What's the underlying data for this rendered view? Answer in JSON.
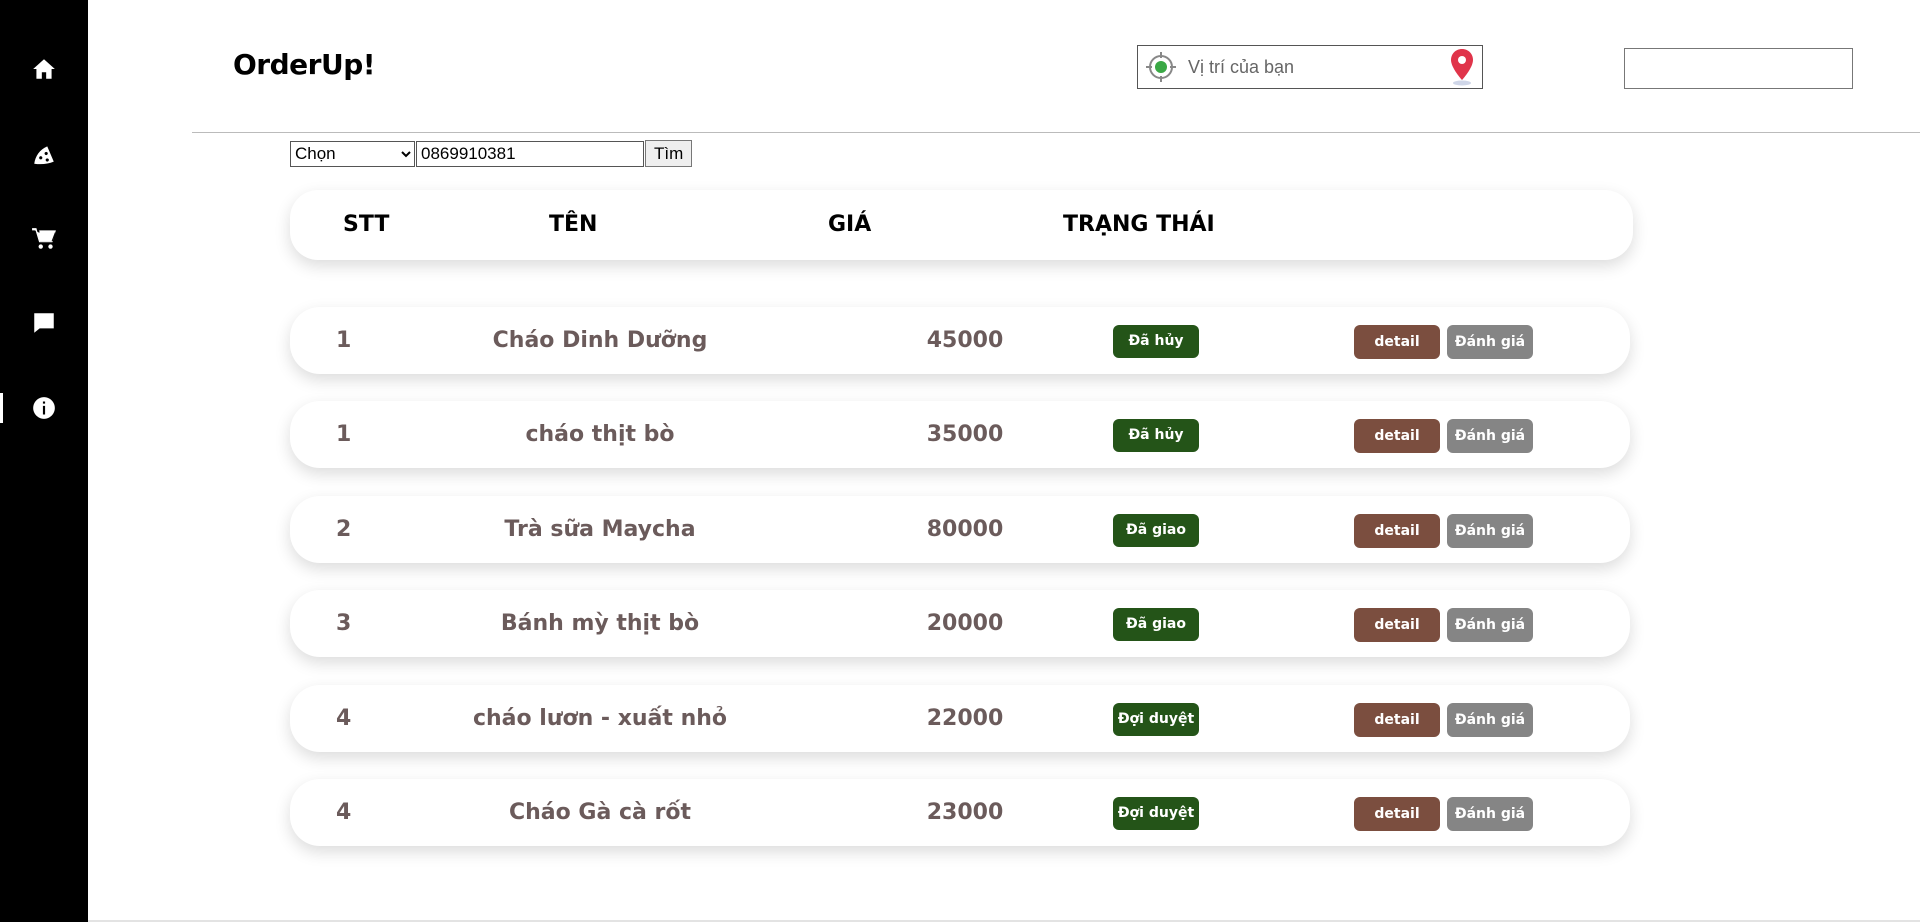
{
  "app": {
    "logo": "OrderUp!"
  },
  "sidebar": {
    "items": [
      {
        "icon": "home-icon",
        "active": false
      },
      {
        "icon": "pizza-icon",
        "active": false
      },
      {
        "icon": "cart-icon",
        "active": false
      },
      {
        "icon": "chat-icon",
        "active": false
      },
      {
        "icon": "info-icon",
        "active": true
      }
    ]
  },
  "header": {
    "location_placeholder": "Vị trí của bạn",
    "search_value": ""
  },
  "filter": {
    "select_value": "Chọn",
    "phone_value": "0869910381",
    "search_button": "Tìm"
  },
  "table": {
    "headers": {
      "stt": "STT",
      "name": "TÊN",
      "price": "GIÁ",
      "status": "TRẠNG THÁI"
    },
    "detail_label": "detail",
    "rate_label": "Đánh giá",
    "rows": [
      {
        "stt": "1",
        "name": "Cháo Dinh Dưỡng",
        "price": "45000",
        "status": "Đã hủy"
      },
      {
        "stt": "1",
        "name": "cháo thịt bò",
        "price": "35000",
        "status": "Đã hủy"
      },
      {
        "stt": "2",
        "name": "Trà sữa Maycha",
        "price": "80000",
        "status": "Đã giao"
      },
      {
        "stt": "3",
        "name": "Bánh mỳ thịt bò",
        "price": "20000",
        "status": "Đã giao"
      },
      {
        "stt": "4",
        "name": "cháo lươn - xuất nhỏ",
        "price": "22000",
        "status": "Đợi duyệt"
      },
      {
        "stt": "4",
        "name": "Cháo Gà cà rốt",
        "price": "23000",
        "status": "Đợi duyệt"
      }
    ]
  },
  "colors": {
    "sidebar": "#000000",
    "status_badge": "#245418",
    "detail_button": "#7b4e3f",
    "rate_button": "#858585",
    "cell_text": "#6b5b5b",
    "location_pin": "#e0344a",
    "location_target": "#3aa845"
  }
}
